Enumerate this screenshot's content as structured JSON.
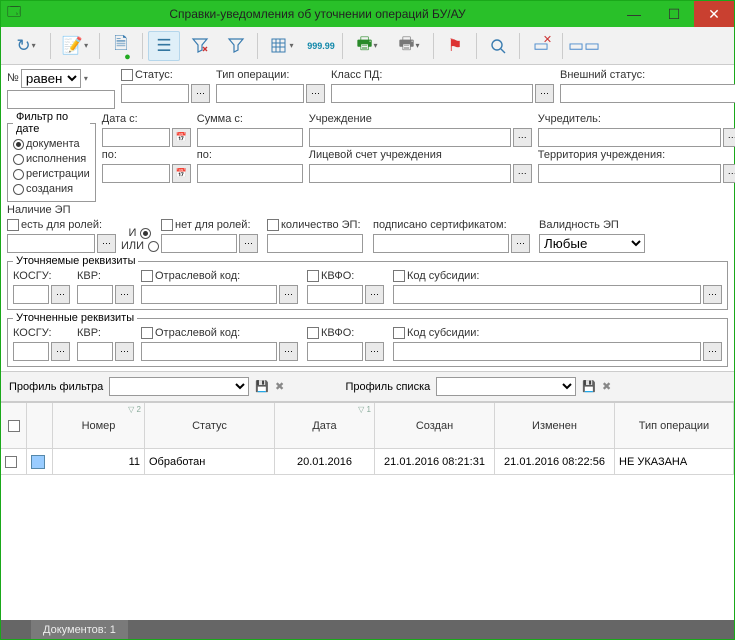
{
  "window": {
    "title": "Справки-уведомления об уточнении операций БУ/АУ"
  },
  "filter": {
    "n_label": "№",
    "n_op": "равен",
    "status": "Статус:",
    "op_type": "Тип операции:",
    "pd_class": "Класс ПД:",
    "ext_status": "Внешний статус:",
    "date_fieldset": "Фильтр по дате",
    "date_doc": "документа",
    "date_exec": "исполнения",
    "date_reg": "регистрации",
    "date_create": "создания",
    "date_from": "Дата с:",
    "date_to": "по:",
    "sum_from": "Сумма с:",
    "sum_to": "по:",
    "org": "Учреждение",
    "org_account": "Лицевой счет учреждения",
    "founder": "Учредитель:",
    "territory": "Территория учреждения:",
    "ep_label": "Наличие ЭП",
    "ep_roles_yes": "есть для ролей:",
    "and": "И",
    "or": "ИЛИ",
    "ep_roles_no": "нет для ролей:",
    "ep_count": "количество ЭП:",
    "signed_cert": "подписано сертификатом:",
    "ep_valid": "Валидность ЭП",
    "ep_valid_val": "Любые",
    "fs1": "Уточняемые реквизиты",
    "fs2": "Уточненные реквизиты",
    "kosgu": "КОСГУ:",
    "kvr": "КВР:",
    "otras": "Отраслевой код:",
    "kvfo": "КВФО:",
    "subsidy": "Код субсидии:"
  },
  "profile": {
    "filter_label": "Профиль фильтра",
    "list_label": "Профиль списка"
  },
  "grid": {
    "cols": [
      "Номер",
      "Статус",
      "Дата",
      "Создан",
      "Изменен",
      "Тип операции"
    ],
    "sort1": "▽ 1",
    "sort2": "▽ 2",
    "row": {
      "num": "11",
      "status": "Обработан",
      "date": "20.01.2016",
      "created": "21.01.2016 08:21:31",
      "changed": "21.01.2016 08:22:56",
      "type": "НЕ УКАЗАНА"
    }
  },
  "status": {
    "docs": "Документов: 1"
  }
}
